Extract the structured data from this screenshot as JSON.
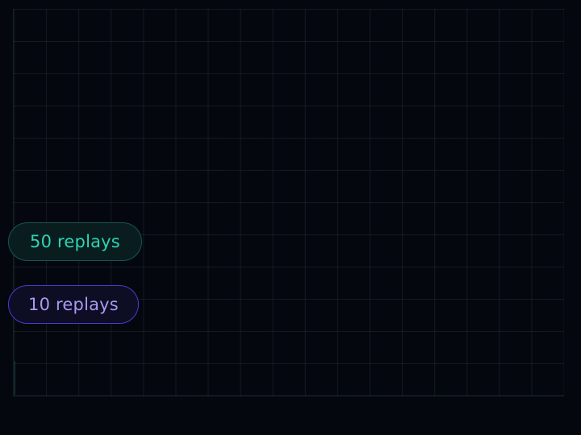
{
  "legend": {
    "items": [
      {
        "label": "50 replays",
        "color": "#2fd3b4",
        "border": "#15574f",
        "background": "#0a1d1e"
      },
      {
        "label": "10 replays",
        "color": "#a79bf2",
        "border": "#4b3bd1",
        "background": "#0d0d24"
      }
    ]
  },
  "theme": {
    "background": "#05070f",
    "grid": "#3c786e"
  }
}
